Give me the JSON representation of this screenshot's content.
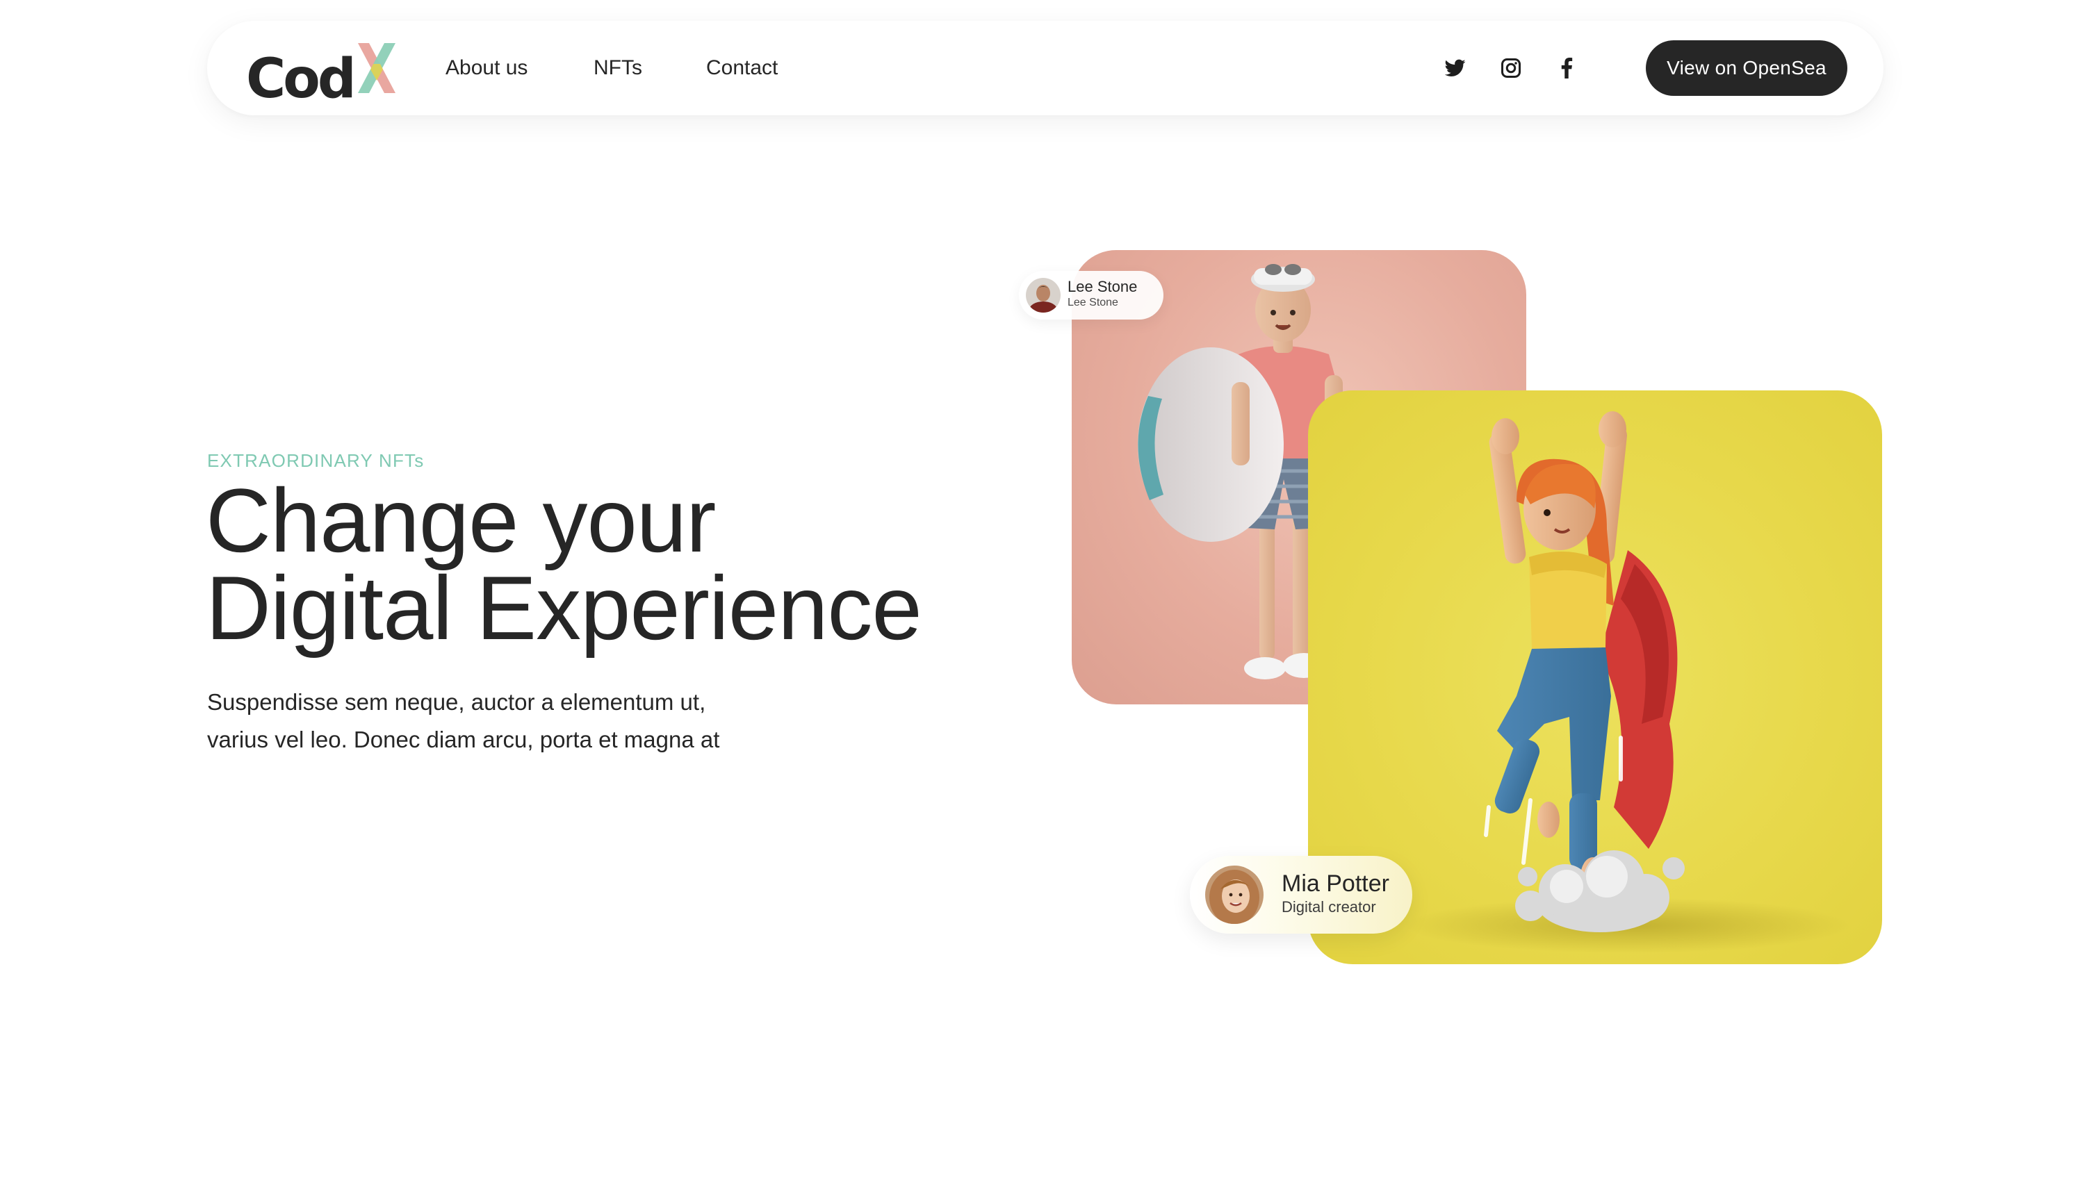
{
  "brand": {
    "logo_main": "Cod",
    "logo_accent": "X",
    "colors": {
      "x_left": "#e9a7a0",
      "x_right": "#8ccfb6",
      "x_center": "#e6d24a"
    }
  },
  "nav": {
    "links": [
      {
        "label": "About us"
      },
      {
        "label": "NFTs"
      },
      {
        "label": "Contact"
      }
    ],
    "social": [
      {
        "icon": "twitter-icon"
      },
      {
        "icon": "instagram-icon"
      },
      {
        "icon": "facebook-icon"
      }
    ],
    "cta_label": "View on OpenSea"
  },
  "hero": {
    "eyebrow": "EXTRAORDINARY NFTs",
    "headline_line1": "Change your",
    "headline_line2": "Digital Experience",
    "subtext_line1": "Suspendisse sem neque, auctor a elementum ut,",
    "subtext_line2": "varius vel leo. Donec diam arcu, porta et magna at"
  },
  "cards": [
    {
      "creator_name": "Lee Stone",
      "creator_role": "Lee Stone",
      "background": "#e6ac9d"
    },
    {
      "creator_name": "Mia Potter",
      "creator_role": "Digital creator",
      "background": "#e7d84a"
    }
  ],
  "colors": {
    "text": "#262626",
    "accent": "#7fc9b2",
    "button_bg": "#262626",
    "button_text": "#ffffff"
  }
}
